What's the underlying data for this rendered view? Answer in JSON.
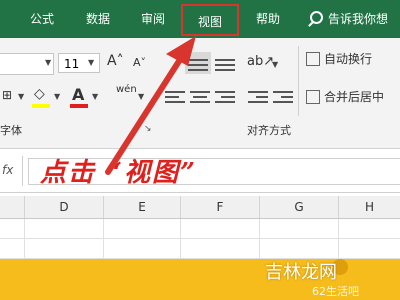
{
  "ribbon_tabs": [
    {
      "label": "公式"
    },
    {
      "label": "数据"
    },
    {
      "label": "审阅"
    },
    {
      "label": "视图"
    },
    {
      "label": "帮助"
    }
  ],
  "tell_me": {
    "text": "告诉我你想"
  },
  "font": {
    "size_value": "11",
    "grow_label": "A˄",
    "shrink_label": "A˅",
    "fill_icon": "paint-bucket-icon",
    "font_color_label": "A",
    "phonetic_label": "wén",
    "group_label": "字体",
    "fill_color": "#ffff00",
    "font_color": "#e02020"
  },
  "alignment": {
    "wrap_text_label": "自动换行",
    "merge_center_label": "合并后居中",
    "group_label": "对齐方式"
  },
  "formula_bar": {
    "fx_label": "fx"
  },
  "annotation": {
    "instruction": "点击 “视图”",
    "color": "#e0201c"
  },
  "columns": [
    "D",
    "E",
    "F",
    "G",
    "H"
  ],
  "watermark": {
    "site_name": "吉林龙网",
    "sub_text": "62生活吧"
  },
  "colors": {
    "ribbon_green": "#217346",
    "highlight_red": "#d9352f",
    "banner_yellow": "#f5bc1c"
  }
}
